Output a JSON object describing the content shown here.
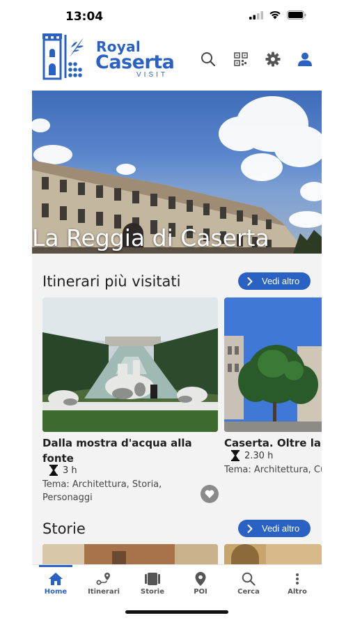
{
  "status": {
    "time": "13:04"
  },
  "header": {
    "logo": {
      "royal": "Royal",
      "caserta": "Caserta",
      "visit": "VISIT"
    },
    "icons": [
      "search-icon",
      "qr-code-icon",
      "gear-icon",
      "user-icon"
    ]
  },
  "hero": {
    "title": "La Reggia di Caserta"
  },
  "itinerari": {
    "title": "Itinerari più visitati",
    "more_label": "Vedi altro",
    "cards": [
      {
        "title": "Dalla mostra d'acqua alla fonte",
        "duration": "3 h",
        "tema": "Tema: Architettura, Storia, Personaggi"
      },
      {
        "title": "Caserta. Oltre la Re",
        "duration": "2.30 h",
        "tema": "Tema: Architettura, Cu"
      }
    ]
  },
  "storie": {
    "title": "Storie",
    "more_label": "Vedi altro"
  },
  "nav": {
    "items": [
      {
        "label": "Home",
        "icon": "home-icon"
      },
      {
        "label": "Itinerari",
        "icon": "route-icon"
      },
      {
        "label": "Storie",
        "icon": "book-icon"
      },
      {
        "label": "POI",
        "icon": "map-pin-icon"
      },
      {
        "label": "Cerca",
        "icon": "search-icon"
      },
      {
        "label": "Altro",
        "icon": "more-vertical-icon"
      }
    ]
  },
  "colors": {
    "brand": "#2a62c4",
    "background": "#f3f3f3"
  }
}
